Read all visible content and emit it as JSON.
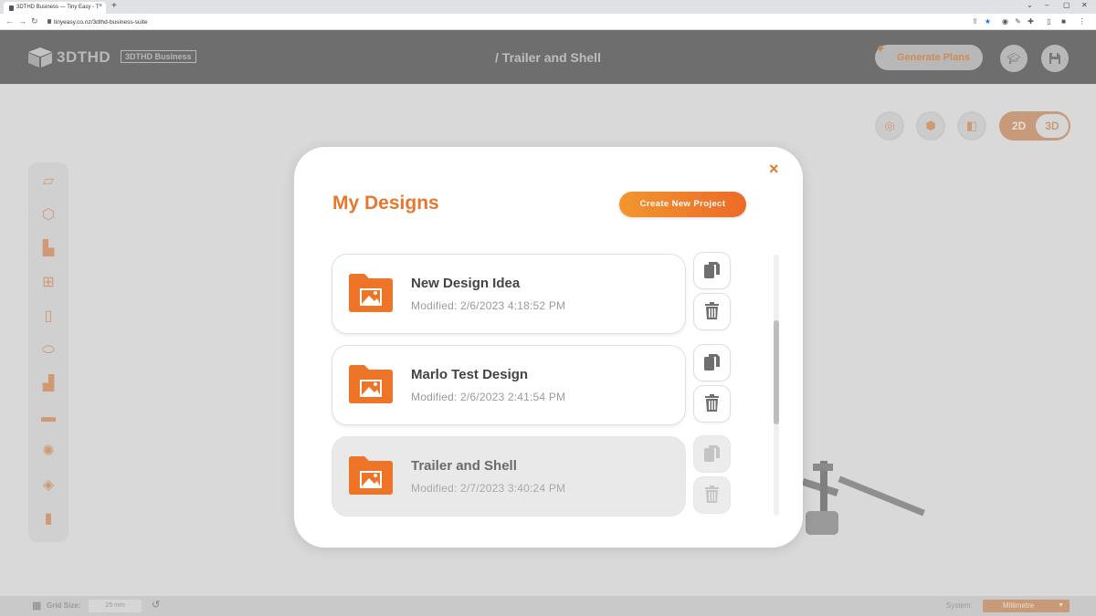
{
  "browser": {
    "tab_title": "3DTHD Business — Tiny Easy - T",
    "tab_close": "×",
    "new_tab": "+",
    "url": "tinyeasy.co.nz/3dthd-business-suite"
  },
  "header": {
    "logo_text": "3DTHD",
    "badge": "3DTHD Business",
    "breadcrumb": "/ Trailer and Shell",
    "generate_plans": "Generate Plans"
  },
  "view_toggle": {
    "option_2d": "2D",
    "option_3d": "3D",
    "active": "3D"
  },
  "modal": {
    "title": "My Designs",
    "close": "×",
    "create_button": "Create New Project",
    "designs": [
      {
        "name": "New Design Idea",
        "modified": "Modified: 2/6/2023 4:18:52 PM",
        "state": "normal"
      },
      {
        "name": "Marlo Test Design",
        "modified": "Modified: 2/6/2023 2:41:54 PM",
        "state": "normal"
      },
      {
        "name": "Trailer and Shell",
        "modified": "Modified: 2/7/2023 3:40:24 PM",
        "state": "current"
      }
    ]
  },
  "bottom_bar": {
    "grid_label": "Grid Size:",
    "grid_value": "25 mm",
    "system_label": "System:",
    "system_value": "Millimetre"
  },
  "colors": {
    "accent": "#e8772e",
    "header_bg": "#6e6e6e",
    "canvas_bg": "#d9d9d9"
  },
  "icons": {
    "tools": [
      "floor-icon",
      "cube-icon",
      "door-icon",
      "window-icon",
      "wall-panel-icon",
      "layer-icon",
      "stairs-icon",
      "sofa-icon",
      "light-icon",
      "paint-icon",
      "bookmark-icon"
    ]
  }
}
